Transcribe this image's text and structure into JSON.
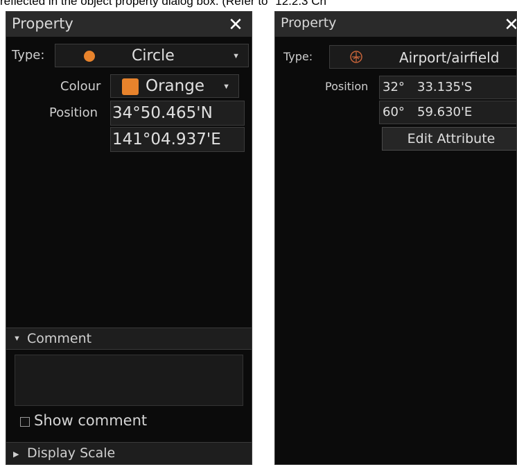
{
  "caption": {
    "text": "reflected in the object property dialog box. (Refer to \"12.2.3 Ch"
  },
  "left_panel": {
    "title": "Property",
    "close_glyph": "✕",
    "type_label": "Type:",
    "type_value": "Circle",
    "type_icon": "orange-circle-icon",
    "colour_label": "Colour",
    "colour_value": "Orange",
    "colour_swatch": "#e8832c",
    "position_label": "Position",
    "position_lat": "34°50.465'N",
    "position_lon": "141°04.937'E",
    "comment_section": "Comment",
    "show_comment_label": "Show comment",
    "show_comment_checked": false,
    "display_scale_section": "Display Scale"
  },
  "right_panel": {
    "title": "Property",
    "close_glyph": "✕",
    "type_label": "Type:",
    "type_value": "Airport/airfield",
    "type_icon": "airport-icon",
    "position_label": "Position",
    "lat_deg": "32°",
    "lat_min": "33.135'S",
    "lon_deg": "60°",
    "lon_min": "59.630'E",
    "edit_button": "Edit Attribute"
  },
  "colors": {
    "panel_bg": "#0b0b0b",
    "accent_orange": "#e8832c",
    "airport_icon": "#c8643a"
  }
}
